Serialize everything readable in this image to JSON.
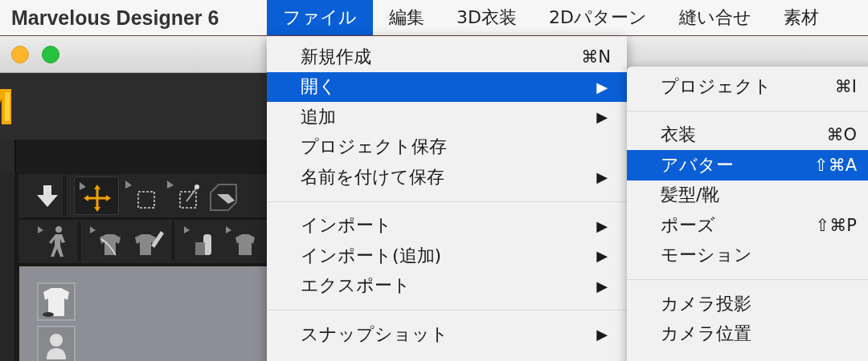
{
  "menubar": {
    "app_name": "Marvelous Designer 6",
    "menus": [
      {
        "label": "ファイル",
        "selected": true
      },
      {
        "label": "編集",
        "selected": false
      },
      {
        "label": "3D衣装",
        "selected": false
      },
      {
        "label": "2Dパターン",
        "selected": false
      },
      {
        "label": "縫い合せ",
        "selected": false
      },
      {
        "label": "素材",
        "selected": false
      }
    ]
  },
  "file_menu": {
    "items": [
      {
        "kind": "item",
        "label": "新規作成",
        "shortcut": "⌘N",
        "selected": false
      },
      {
        "kind": "item",
        "label": "開く",
        "arrow": "▶",
        "selected": true
      },
      {
        "kind": "item",
        "label": "追加",
        "arrow": "▶",
        "selected": false
      },
      {
        "kind": "item",
        "label": "プロジェクト保存",
        "selected": false
      },
      {
        "kind": "item",
        "label": "名前を付けて保存",
        "arrow": "▶",
        "selected": false
      },
      {
        "kind": "separator"
      },
      {
        "kind": "item",
        "label": "インポート",
        "arrow": "▶",
        "selected": false
      },
      {
        "kind": "item",
        "label": "インポート(追加)",
        "arrow": "▶",
        "selected": false
      },
      {
        "kind": "item",
        "label": "エクスポート",
        "arrow": "▶",
        "selected": false
      },
      {
        "kind": "separator"
      },
      {
        "kind": "item",
        "label": "スナップショット",
        "arrow": "▶",
        "selected": false
      }
    ]
  },
  "open_submenu": {
    "items": [
      {
        "kind": "item",
        "label": "プロジェクト",
        "shortcut": "⌘I",
        "selected": false
      },
      {
        "kind": "separator"
      },
      {
        "kind": "item",
        "label": "衣装",
        "shortcut": "⌘O",
        "selected": false
      },
      {
        "kind": "item",
        "label": "アバター",
        "shortcut": "⇧⌘A",
        "selected": true
      },
      {
        "kind": "item",
        "label": "髪型/靴",
        "selected": false
      },
      {
        "kind": "item",
        "label": "ポーズ",
        "shortcut": "⇧⌘P",
        "selected": false
      },
      {
        "kind": "item",
        "label": "モーション",
        "selected": false
      },
      {
        "kind": "separator"
      },
      {
        "kind": "item",
        "label": "カメラ投影",
        "selected": false
      },
      {
        "kind": "item",
        "label": "カメラ位置",
        "selected": false
      }
    ]
  }
}
